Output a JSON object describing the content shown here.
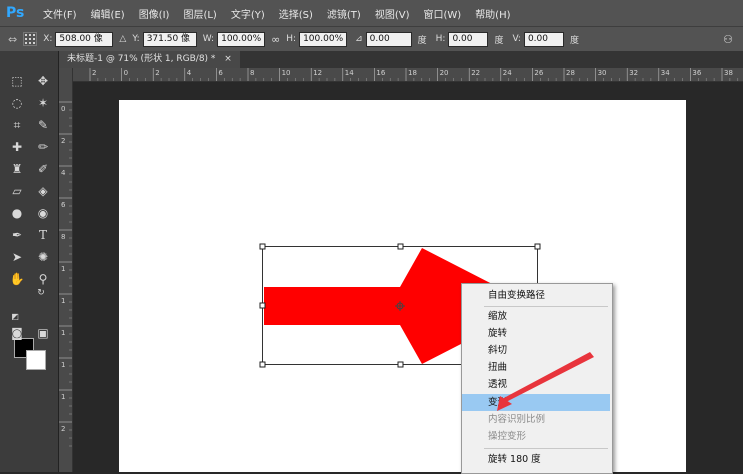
{
  "app": {
    "logo": "Ps"
  },
  "menu": [
    "文件(F)",
    "编辑(E)",
    "图像(I)",
    "图层(L)",
    "文字(Y)",
    "选择(S)",
    "滤镜(T)",
    "视图(V)",
    "窗口(W)",
    "帮助(H)"
  ],
  "options": {
    "x_label": "X:",
    "x_value": "508.00 像",
    "y_label": "Y:",
    "y_value": "371.50 像",
    "w_label": "W:",
    "w_value": "100.00%",
    "h_label": "H:",
    "h_value": "100.00%",
    "angle_value": "0.00",
    "angle_unit": "度",
    "hskew_label": "H:",
    "hskew_value": "0.00",
    "hskew_unit": "度",
    "vskew_label": "V:",
    "vskew_value": "0.00",
    "vskew_unit": "度"
  },
  "document": {
    "tab_title": "未标题-1 @ 71% (形状 1, RGB/8) *",
    "close": "×"
  },
  "ruler": {
    "h_ticks": [
      "2",
      "0",
      "2",
      "4",
      "6",
      "8",
      "10",
      "12",
      "14",
      "16",
      "18",
      "20",
      "22",
      "24",
      "26",
      "28",
      "30",
      "32",
      "34",
      "36",
      "38"
    ],
    "v_ticks": [
      "0",
      "2",
      "4",
      "6",
      "8",
      "1",
      "1",
      "1",
      "1",
      "1",
      "2"
    ]
  },
  "context_menu": {
    "items": [
      {
        "label": "自由变换路径",
        "disabled": false,
        "highlighted": false
      },
      {
        "label": "缩放",
        "disabled": false,
        "highlighted": false
      },
      {
        "label": "旋转",
        "disabled": false,
        "highlighted": false
      },
      {
        "label": "斜切",
        "disabled": false,
        "highlighted": false
      },
      {
        "label": "扭曲",
        "disabled": false,
        "highlighted": false
      },
      {
        "label": "透视",
        "disabled": false,
        "highlighted": false
      },
      {
        "label": "变形",
        "disabled": false,
        "highlighted": true
      },
      {
        "label": "内容识别比例",
        "disabled": true,
        "highlighted": false
      },
      {
        "label": "操控变形",
        "disabled": true,
        "highlighted": false
      },
      {
        "label": "旋转 180 度",
        "disabled": false,
        "highlighted": false
      }
    ]
  },
  "colors": {
    "shape_fill": "#ff0000",
    "foreground": "#000000",
    "background": "#ffffff",
    "highlight": "#99c9f2",
    "annotation": "#e8343c"
  }
}
